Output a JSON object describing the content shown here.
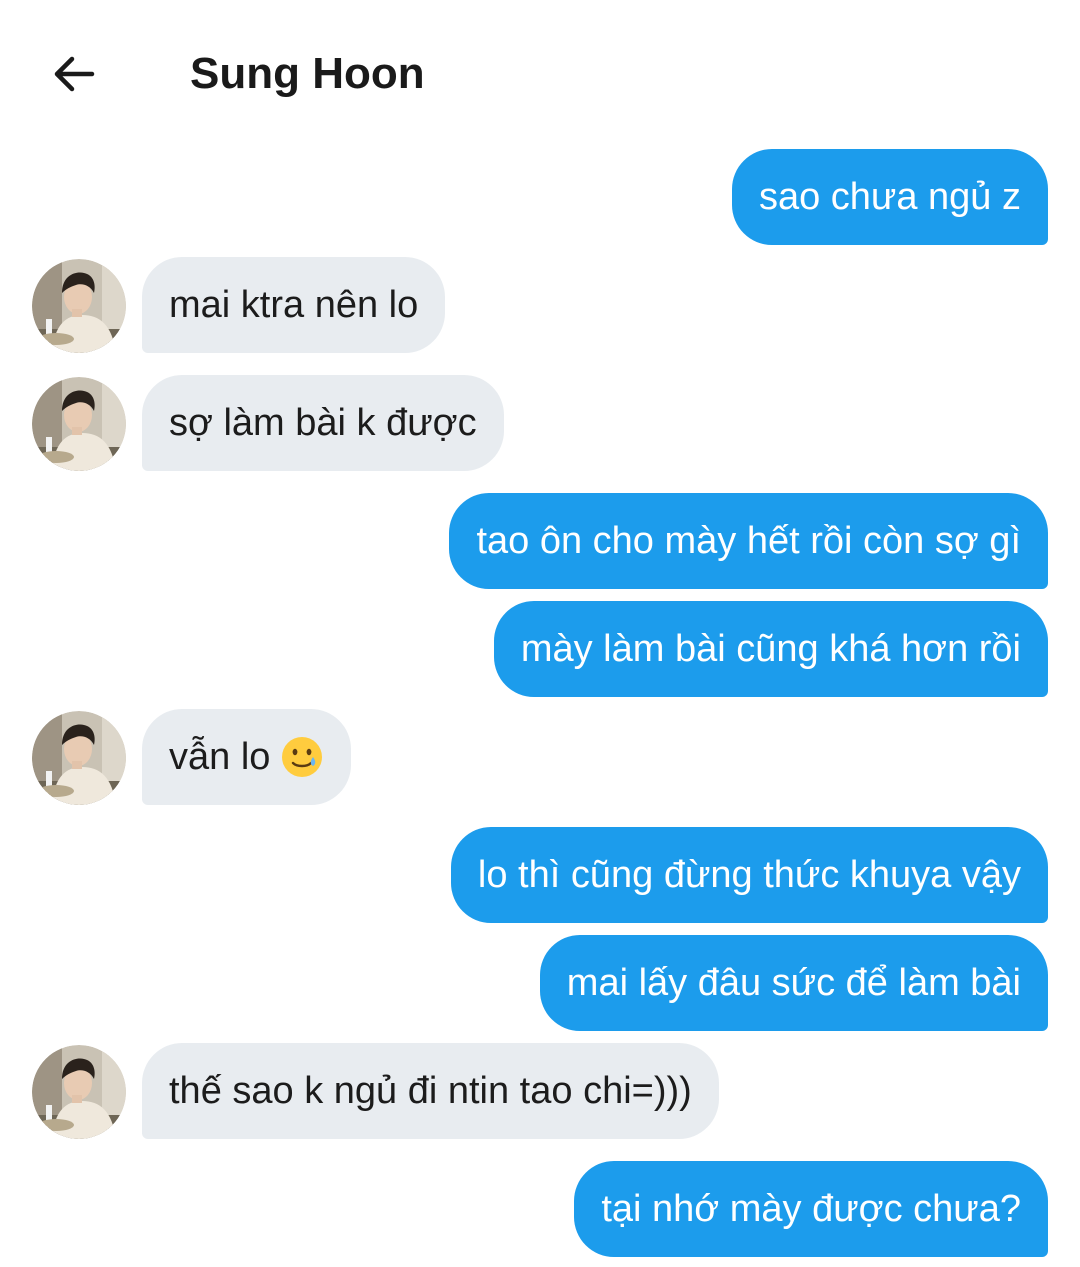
{
  "header": {
    "title": "Sung Hoon",
    "back_icon": "arrow-left-icon"
  },
  "colors": {
    "sent_bubble": "#1c9cec",
    "received_bubble": "#e8ecf0"
  },
  "messages": [
    {
      "direction": "sent",
      "text": "sao chưa ngủ z"
    },
    {
      "direction": "received",
      "text": "mai ktra nên lo"
    },
    {
      "direction": "received",
      "text": "sợ làm bài k được"
    },
    {
      "direction": "sent",
      "text": "tao ôn cho mày hết rồi còn sợ gì"
    },
    {
      "direction": "sent",
      "text": "mày làm bài cũng khá hơn rồi"
    },
    {
      "direction": "received",
      "text": "vẫn lo",
      "emoji": "smiling-face-with-tear-icon"
    },
    {
      "direction": "sent",
      "text": "lo thì cũng đừng thức khuya vậy"
    },
    {
      "direction": "sent",
      "text": "mai lấy đâu sức để làm bài"
    },
    {
      "direction": "received",
      "text": "thế sao k ngủ đi ntin tao chi=)))"
    },
    {
      "direction": "sent",
      "text": "tại nhớ mày được chưa?"
    }
  ]
}
